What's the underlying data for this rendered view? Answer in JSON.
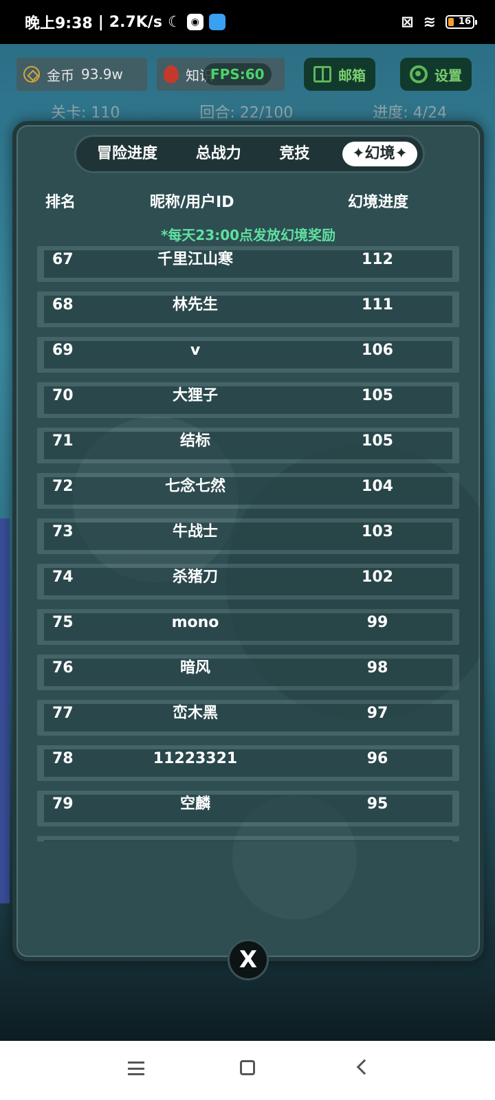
{
  "status_bar": {
    "time": "晚上9:38",
    "net_speed": "2.7K/s",
    "battery": "16"
  },
  "top_bar": {
    "coin_label": "金币",
    "coin_value": "93.9w",
    "knowledge_label": "知识",
    "fps": "FPS:60",
    "mail_label": "邮箱",
    "settings_label": "设置"
  },
  "info_bar": {
    "level": "关卡: 110",
    "round": "回合: 22/100",
    "progress": "进度: 4/24"
  },
  "tabs": [
    {
      "label": "冒险进度"
    },
    {
      "label": "总战力"
    },
    {
      "label": "竞技"
    },
    {
      "label": "✦幻境✦"
    }
  ],
  "table": {
    "headers": [
      "排名",
      "昵称/用户ID",
      "幻境进度"
    ],
    "notice": "*每天23:00点发放幻境奖励",
    "rows": [
      {
        "rank": "67",
        "name": "千里江山寒",
        "progress": "112"
      },
      {
        "rank": "68",
        "name": "林先生",
        "progress": "111"
      },
      {
        "rank": "69",
        "name": "v",
        "progress": "106"
      },
      {
        "rank": "70",
        "name": "大狸子",
        "progress": "105"
      },
      {
        "rank": "71",
        "name": "结标",
        "progress": "105"
      },
      {
        "rank": "72",
        "name": "七念七然",
        "progress": "104"
      },
      {
        "rank": "73",
        "name": "牛战士",
        "progress": "103"
      },
      {
        "rank": "74",
        "name": "杀猪刀",
        "progress": "102"
      },
      {
        "rank": "75",
        "name": "mono",
        "progress": "99"
      },
      {
        "rank": "76",
        "name": "暗风",
        "progress": "98"
      },
      {
        "rank": "77",
        "name": "峦木黑",
        "progress": "97"
      },
      {
        "rank": "78",
        "name": "11223321",
        "progress": "96"
      },
      {
        "rank": "79",
        "name": "空麟",
        "progress": "95"
      }
    ]
  },
  "close_label": "X",
  "icons": {
    "coin": "coin-icon",
    "knowledge": "flame-icon",
    "mail": "gift-icon",
    "settings": "gear-icon"
  },
  "colors": {
    "accent_green": "#5fe0a0",
    "fps_green": "#4cd36a",
    "modal_bg": "#2e4e52"
  }
}
